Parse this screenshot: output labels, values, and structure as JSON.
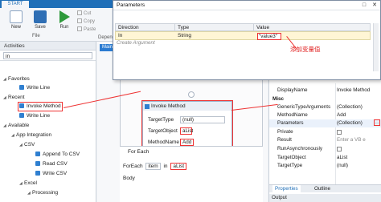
{
  "ribbon": {
    "start_tab": "START",
    "new_label": "New",
    "save_label": "Save",
    "run_label": "Run",
    "file_group": "File",
    "cut_label": "Cut",
    "copy_label": "Copy",
    "paste_label": "Paste",
    "dependencies_label": "Depend"
  },
  "activities": {
    "title": "Activities",
    "search_value": "in",
    "favorites": "Favorites",
    "write_line_1": "Write Line",
    "recent": "Recent",
    "invoke_method": "Invoke Method",
    "write_line_2": "Write Line",
    "available": "Available",
    "app_integration": "App Integration",
    "csv": "CSV",
    "append_to_csv": "Append To CSV",
    "read_csv": "Read CSV",
    "write_csv": "Write CSV",
    "excel": "Excel",
    "processing": "Processing"
  },
  "designer": {
    "tab_label": "Main",
    "sequence_label": "Main",
    "invoke": {
      "title": "Invoke Method",
      "target_type_label": "TargetType",
      "target_type_value": "(null)",
      "target_object_label": "TargetObject",
      "target_object_value": "aList",
      "method_name_label": "MethodName",
      "method_name_value": "Add"
    },
    "foreach": {
      "title": "For Each",
      "for_each_label": "ForEach",
      "item_value": "item",
      "in_label": "in",
      "list_value": "aList",
      "body_label": "Body"
    }
  },
  "properties": {
    "display_name_label": "DisplayName",
    "display_name_value": "Invoke Method",
    "misc_section": "Misc",
    "generic_type_label": "GenericTypeArguments",
    "generic_type_value": "(Collection)",
    "method_name_label": "MethodName",
    "method_name_value": "Add",
    "parameters_label": "Parameters",
    "parameters_value": "(Collection)",
    "private_label": "Private",
    "result_label": "Result",
    "result_placeholder": "Enter a VB e",
    "run_async_label": "RunAsynchronously",
    "target_object_label": "TargetObject",
    "target_object_value": "aList",
    "target_type_label": "TargetType",
    "target_type_value": "(null)",
    "tab_properties": "Properties",
    "tab_outline": "Outline",
    "output_label": "Output"
  },
  "dialog": {
    "title": "Parameters",
    "columns": [
      "Direction",
      "Type",
      "Value"
    ],
    "row": {
      "direction": "In",
      "type": "String",
      "value": "\"value3\""
    },
    "create_argument": "Create Argument",
    "annotation": "添加变量值"
  },
  "colors": {
    "accent": "#1f6fb8",
    "highlight": "#e33333",
    "selected_row": "#fff6d5"
  }
}
